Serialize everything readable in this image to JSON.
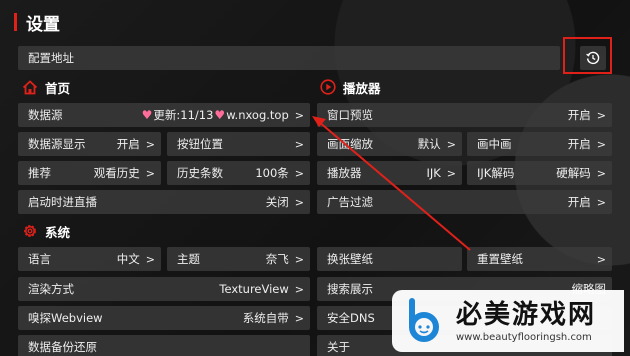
{
  "page_title": "设置",
  "config": {
    "label": "配置地址"
  },
  "sections": {
    "home": "首页",
    "player": "播放器",
    "system": "系统"
  },
  "home": {
    "datasource": {
      "label": "数据源",
      "value_prefix": "更新:11/13",
      "value_suffix": "w.nxog.top",
      "chevron": ">"
    },
    "datasource_display": {
      "label": "数据源显示",
      "value": "开启",
      "chevron": ">"
    },
    "button_position": {
      "label": "按钮位置",
      "chevron": ">"
    },
    "recommend": {
      "label": "推荐",
      "value": "观看历史",
      "chevron": ">"
    },
    "history_count": {
      "label": "历史条数",
      "value": "100条",
      "chevron": ">"
    },
    "live_on_start": {
      "label": "启动时进直播",
      "value": "关闭",
      "chevron": ">"
    }
  },
  "player": {
    "window_preview": {
      "label": "窗口预览",
      "value": "开启",
      "chevron": ">"
    },
    "scale": {
      "label": "画面缩放",
      "value": "默认",
      "chevron": ">"
    },
    "pip": {
      "label": "画中画",
      "value": "开启",
      "chevron": ">"
    },
    "player": {
      "label": "播放器",
      "value": "IJK",
      "chevron": ">"
    },
    "ijk_decode": {
      "label": "IJK解码",
      "value": "硬解码",
      "chevron": ">"
    },
    "ad_filter": {
      "label": "广告过滤",
      "value": "开启",
      "chevron": ">"
    }
  },
  "system": {
    "language": {
      "label": "语言",
      "value": "中文",
      "chevron": ">"
    },
    "theme": {
      "label": "主题",
      "value": "奈飞",
      "chevron": ">"
    },
    "render": {
      "label": "渲染方式",
      "value": "TextureView",
      "chevron": ">"
    },
    "webview": {
      "label": "嗅探Webview",
      "value": "系统自带",
      "chevron": ">"
    },
    "backup": {
      "label": "数据备份还原"
    },
    "wallpaper_change": {
      "label": "换张壁纸"
    },
    "wallpaper_reset": {
      "label": "重置壁纸",
      "chevron": ">"
    },
    "search_display": {
      "label": "搜索展示",
      "value": "缩略图"
    },
    "secure_dns": {
      "label": "安全DNS"
    },
    "about": {
      "label": "关于"
    }
  },
  "watermark": {
    "title": "必美游戏网",
    "url": "www.beautyflooringsh.com"
  },
  "colors": {
    "accent": "#e0211a",
    "heart": "#ff6e9b",
    "cell_bg": "#3a3a3a",
    "page_bg": "#161616"
  },
  "icons": {
    "home": "home-icon",
    "player": "play-circle-icon",
    "system": "gear-icon",
    "history": "history-clock-icon",
    "logo": "b-logo-icon"
  }
}
